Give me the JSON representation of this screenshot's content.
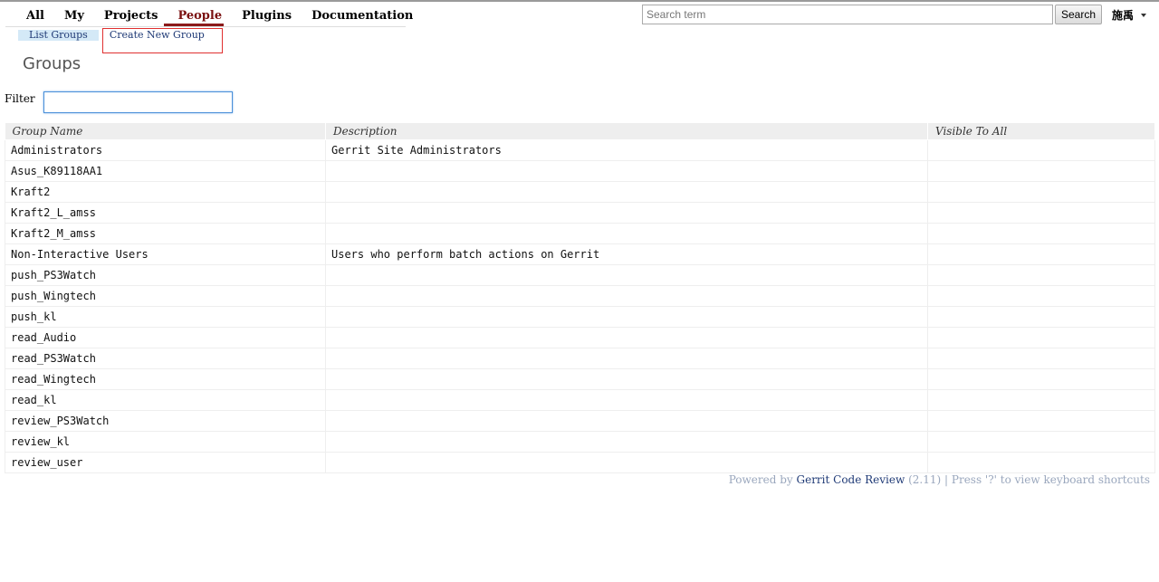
{
  "topnav": {
    "items": [
      {
        "label": "All"
      },
      {
        "label": "My"
      },
      {
        "label": "Projects"
      },
      {
        "label": "People",
        "selected": true
      },
      {
        "label": "Plugins"
      },
      {
        "label": "Documentation"
      }
    ]
  },
  "subnav": {
    "list_groups": "List Groups",
    "create_new_group": "Create New Group"
  },
  "search": {
    "placeholder": "Search term",
    "value": "",
    "button_label": "Search"
  },
  "user": {
    "name": "施禹"
  },
  "page": {
    "title": "Groups"
  },
  "filter": {
    "label": "Filter",
    "value": ""
  },
  "table": {
    "columns": [
      "Group Name",
      "Description",
      "Visible To All"
    ],
    "rows": [
      {
        "name": "Administrators",
        "description": "Gerrit Site Administrators",
        "visible": ""
      },
      {
        "name": "Asus_K89118AA1",
        "description": "",
        "visible": ""
      },
      {
        "name": "Kraft2",
        "description": "",
        "visible": ""
      },
      {
        "name": "Kraft2_L_amss",
        "description": "",
        "visible": ""
      },
      {
        "name": "Kraft2_M_amss",
        "description": "",
        "visible": ""
      },
      {
        "name": "Non-Interactive Users",
        "description": "Users who perform batch actions on Gerrit",
        "visible": ""
      },
      {
        "name": "push_PS3Watch",
        "description": "",
        "visible": ""
      },
      {
        "name": "push_Wingtech",
        "description": "",
        "visible": ""
      },
      {
        "name": "push_kl",
        "description": "",
        "visible": ""
      },
      {
        "name": "read_Audio",
        "description": "",
        "visible": ""
      },
      {
        "name": "read_PS3Watch",
        "description": "",
        "visible": ""
      },
      {
        "name": "read_Wingtech",
        "description": "",
        "visible": ""
      },
      {
        "name": "read_kl",
        "description": "",
        "visible": ""
      },
      {
        "name": "review_PS3Watch",
        "description": "",
        "visible": ""
      },
      {
        "name": "review_kl",
        "description": "",
        "visible": ""
      },
      {
        "name": "review_user",
        "description": "",
        "visible": ""
      }
    ]
  },
  "footer": {
    "powered_by": "Powered by",
    "gerrit_link": "Gerrit Code Review",
    "version": "(2.11)",
    "separator": "|",
    "shortcuts_hint": "Press '?' to view keyboard shortcuts"
  }
}
